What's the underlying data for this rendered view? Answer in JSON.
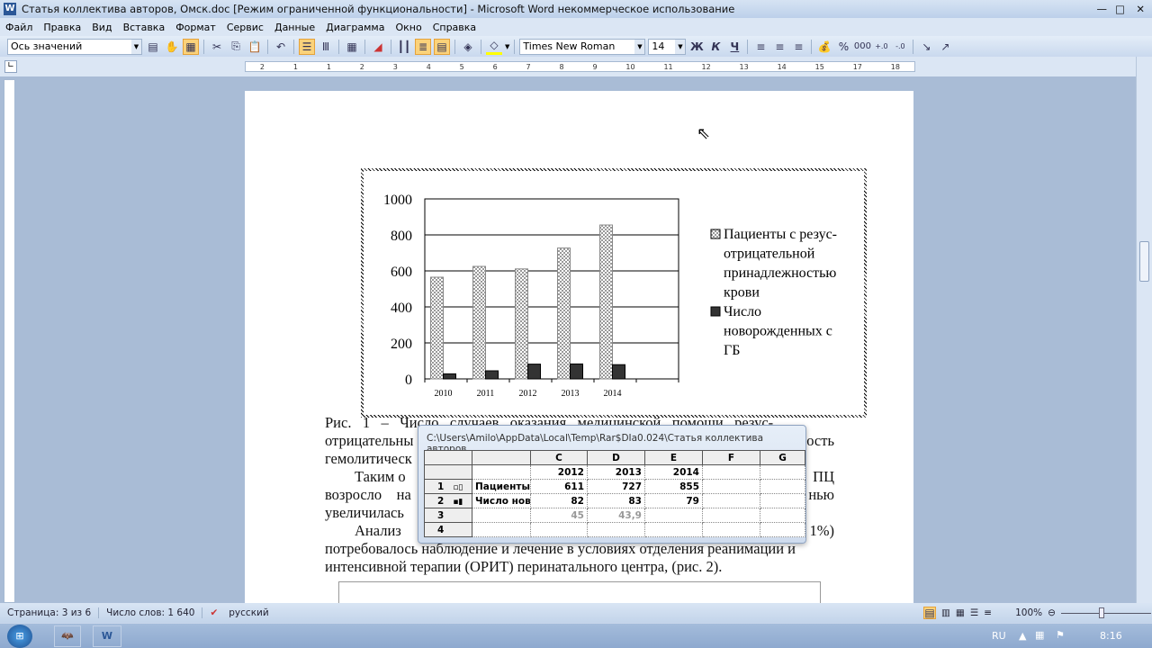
{
  "window": {
    "title": "Статья коллектива авторов, Омск.doc [Режим ограниченной функциональности] - Microsoft Word некоммерческое использование"
  },
  "menu": [
    "Файл",
    "Правка",
    "Вид",
    "Вставка",
    "Формат",
    "Сервис",
    "Данные",
    "Диаграмма",
    "Окно",
    "Справка"
  ],
  "toolbar": {
    "object_select": "Ось значений",
    "font": "Times New Roman",
    "size": "14",
    "bold": "Ж",
    "italic": "К",
    "underline": "Ч",
    "percent": "%",
    "thousands": "000"
  },
  "ruler": [
    "2",
    "1",
    "1",
    "2",
    "3",
    "4",
    "5",
    "6",
    "7",
    "8",
    "9",
    "10",
    "11",
    "12",
    "13",
    "14",
    "15",
    "17",
    "18"
  ],
  "chart_data": {
    "type": "bar",
    "categories": [
      "2010",
      "2011",
      "2012",
      "2013",
      "2014"
    ],
    "ylim": [
      0,
      1000
    ],
    "yticks": [
      "0",
      "200",
      "400",
      "600",
      "800",
      "1000"
    ],
    "grid": true,
    "legend_position": "right",
    "series": [
      {
        "name": "Пациенты с резус-отрицательной принадлежностью крови",
        "values": [
          565,
          625,
          611,
          727,
          855
        ],
        "pattern": "checkered"
      },
      {
        "name": "Число новорожденных с ГБ",
        "values": [
          28,
          45,
          82,
          83,
          79
        ],
        "color": "#333333"
      }
    ],
    "legend_lines": [
      [
        "Пациенты с резус-",
        "отрицательной",
        "принадлежностью",
        "крови"
      ],
      [
        "Число",
        "новорожденных с",
        "ГБ"
      ]
    ]
  },
  "document": {
    "lines": [
      {
        "l": "Рис.   1   –   Число   случаев   оказания   медицинской   помощи   резус-",
        "r": ""
      },
      {
        "l": "отрицательны",
        "r": "ость"
      },
      {
        "l": "гемолитическ",
        "r": ""
      },
      {
        "l": "        Таким о",
        "r": "ПЦ"
      },
      {
        "l": "возросло    на",
        "r": "нью"
      },
      {
        "l": "увеличилась",
        "r": ""
      },
      {
        "l": "        Анализ",
        "r": "1%)"
      },
      {
        "l": "потребовалось наблюдение и лечение в условиях отделения реанимации и",
        "r": ""
      },
      {
        "l": "интенсивной терапии (ОРИТ) перинатального центра, (рис. 2).",
        "r": ""
      }
    ]
  },
  "datasheet": {
    "title": "C:\\Users\\Amilo\\AppData\\Local\\Temp\\Rar$DIa0.024\\Статья коллектива авторов, ...",
    "columns": [
      "",
      "",
      "C",
      "D",
      "E",
      "F",
      "G"
    ],
    "years": [
      "2012",
      "2013",
      "2014"
    ],
    "rows": [
      {
        "num": "1",
        "label": "Пациенты с",
        "values": [
          "611",
          "727",
          "855"
        ]
      },
      {
        "num": "2",
        "label": "Число ново",
        "values": [
          "82",
          "83",
          "79"
        ]
      },
      {
        "num": "3",
        "label": "",
        "values": [
          "45",
          "43,9",
          ""
        ]
      },
      {
        "num": "4",
        "label": "",
        "values": [
          "",
          "",
          ""
        ]
      }
    ]
  },
  "status": {
    "page": "Страница: 3 из 6",
    "words": "Число слов: 1 640",
    "lang": "русский",
    "zoom": "100%"
  },
  "taskbar": {
    "lang": "RU",
    "time": "8:16"
  }
}
